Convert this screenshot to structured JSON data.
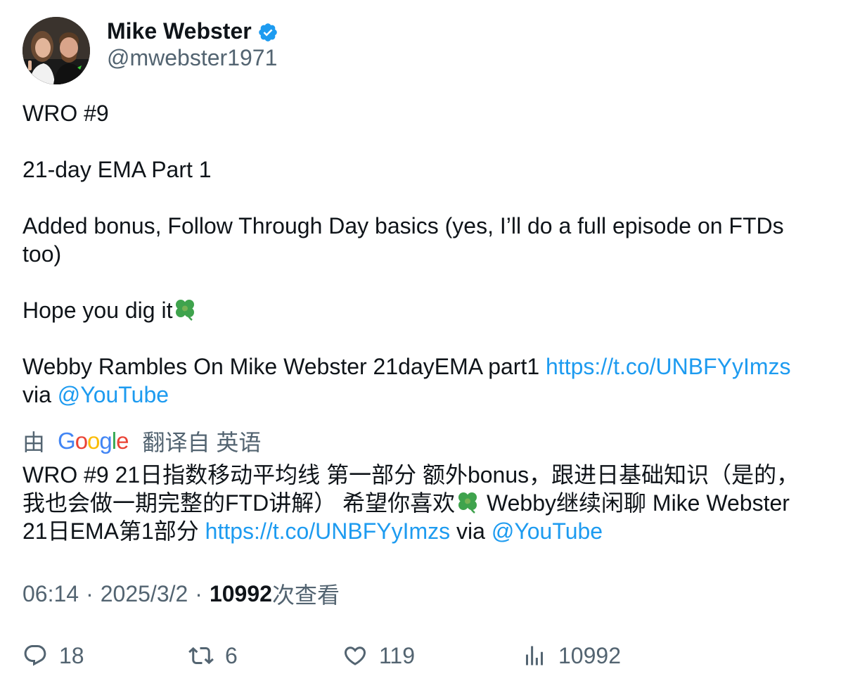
{
  "author": {
    "display_name": "Mike Webster",
    "handle": "@mwebster1971",
    "verified": true
  },
  "tweet": {
    "line1": "WRO #9",
    "line2": "21-day EMA Part 1",
    "line3": "Added bonus, Follow Through Day  basics (yes, I’ll do a full episode on FTDs too)",
    "line4_text": "Hope you dig it",
    "line4_emoji": "four-leaf-clover",
    "line5_text": "Webby Rambles On Mike Webster 21dayEMA part1 ",
    "line5_link": "https://t.co/UNBFYyImzs",
    "line6_via": "via ",
    "line6_mention": "@YouTube"
  },
  "translation": {
    "prefix": "由",
    "google": [
      "G",
      "o",
      "o",
      "g",
      "l",
      "e"
    ],
    "suffix": "翻译自 英语",
    "text_a": "WRO #9 21日指数移动平均线 第一部分 额外bonus，跟进日基础知识（是的，我也会做一期完整的FTD讲解） 希望你喜欢",
    "text_b": " Webby继续闲聊 Mike Webster 21日EMA第1部分 ",
    "link": "https://t.co/UNBFYyImzs",
    "via": " via ",
    "mention": "@YouTube"
  },
  "meta": {
    "time": "06:14",
    "separator": "·",
    "date": "2025/3/2",
    "views_count": "10992",
    "views_label": "次查看"
  },
  "actions": {
    "replies": "18",
    "retweets": "6",
    "likes": "119",
    "views": "10992"
  },
  "colors": {
    "link": "#1d9bf0",
    "secondary_text": "#536471",
    "primary_text": "#0f1419"
  }
}
